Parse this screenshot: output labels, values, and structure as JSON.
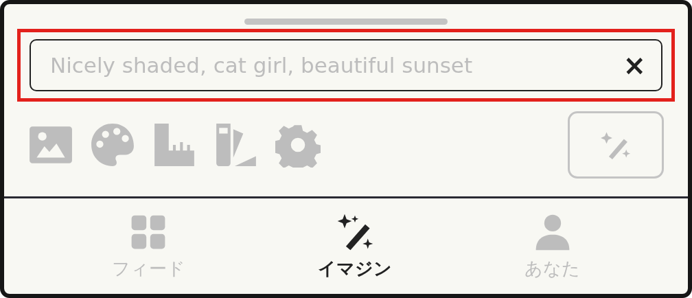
{
  "search": {
    "placeholder": "Nicely shaded, cat girl, beautiful sunset",
    "clear": "×",
    "highlighted": true
  },
  "generate_button": {
    "disabled": true
  },
  "tabs": [
    {
      "kind": "feed",
      "label": "フィード",
      "selected": false
    },
    {
      "kind": "imagine",
      "label": "イマジン",
      "selected": true
    },
    {
      "kind": "you",
      "label": "あなた",
      "selected": false
    }
  ]
}
